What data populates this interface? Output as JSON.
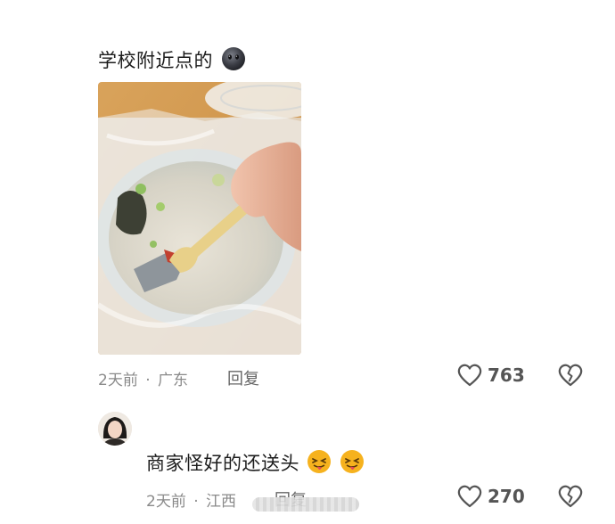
{
  "comments": [
    {
      "text": "学校附近点的",
      "emoji": "dark-face-emoji",
      "has_photo": true,
      "time": "2天前",
      "separator": "·",
      "location": "广东",
      "reply_label": "回复",
      "likes": "763"
    },
    {
      "text": "商家怪好的还送头",
      "emoji": "tongue-wink-emoji",
      "time": "2天前",
      "separator": "·",
      "location": "江西",
      "reply_label": "回复",
      "likes": "270"
    }
  ],
  "colors": {
    "meta": "#8a8a8a",
    "text": "#1c1c1c",
    "icon": "#555555",
    "emoji_yellow": "#f6b21e",
    "dark_emoji": "#33343b"
  }
}
